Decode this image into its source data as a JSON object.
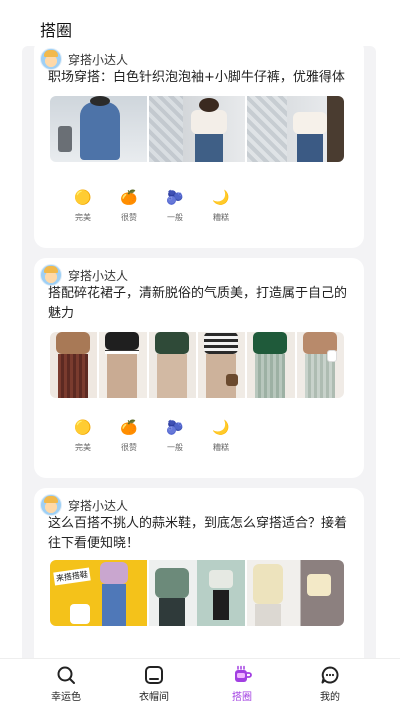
{
  "header": {
    "title": "搭圈"
  },
  "posts": [
    {
      "username": "穿搭小达人",
      "text": "职场穿搭：白色针织泡泡袖+小脚牛仔裤，优雅得体",
      "image_icons": [
        "photo-blue-dress",
        "photo-white-blouse-jeans",
        "photo-white-blouse-window"
      ]
    },
    {
      "username": "穿搭小达人",
      "text": "搭配碎花裙子，清新脱俗的气质美，打造属于自己的魅力",
      "image_icons": [
        "photo-outfit-1",
        "photo-outfit-2",
        "photo-outfit-3",
        "photo-outfit-4",
        "photo-outfit-5",
        "photo-outfit-6"
      ]
    },
    {
      "username": "穿搭小达人",
      "text": "这么百搭不挑人的蒜米鞋，到底怎么穿搭适合？接着往下看便知晓！",
      "image_icons": [
        "photo-yellow-jeans",
        "photo-green-outfit",
        "photo-light-outfit"
      ]
    }
  ],
  "photo_texts": {
    "post3_sticker": "来搭搭鞋"
  },
  "reactions": [
    {
      "label": "完美",
      "emoji": "🟡",
      "icon": "perfect-icon"
    },
    {
      "label": "很赞",
      "emoji": "🍊",
      "icon": "great-icon"
    },
    {
      "label": "一般",
      "emoji": "🫐",
      "icon": "average-icon"
    },
    {
      "label": "糟糕",
      "emoji": "🌙",
      "icon": "bad-icon"
    }
  ],
  "nav": {
    "items": [
      {
        "label": "幸运色",
        "icon": "search-icon"
      },
      {
        "label": "衣帽间",
        "icon": "wardrobe-icon"
      },
      {
        "label": "搭圈",
        "icon": "coffee-cup-icon"
      },
      {
        "label": "我的",
        "icon": "chat-icon"
      }
    ],
    "active_index": 2,
    "active_color": "#a23fe2"
  }
}
